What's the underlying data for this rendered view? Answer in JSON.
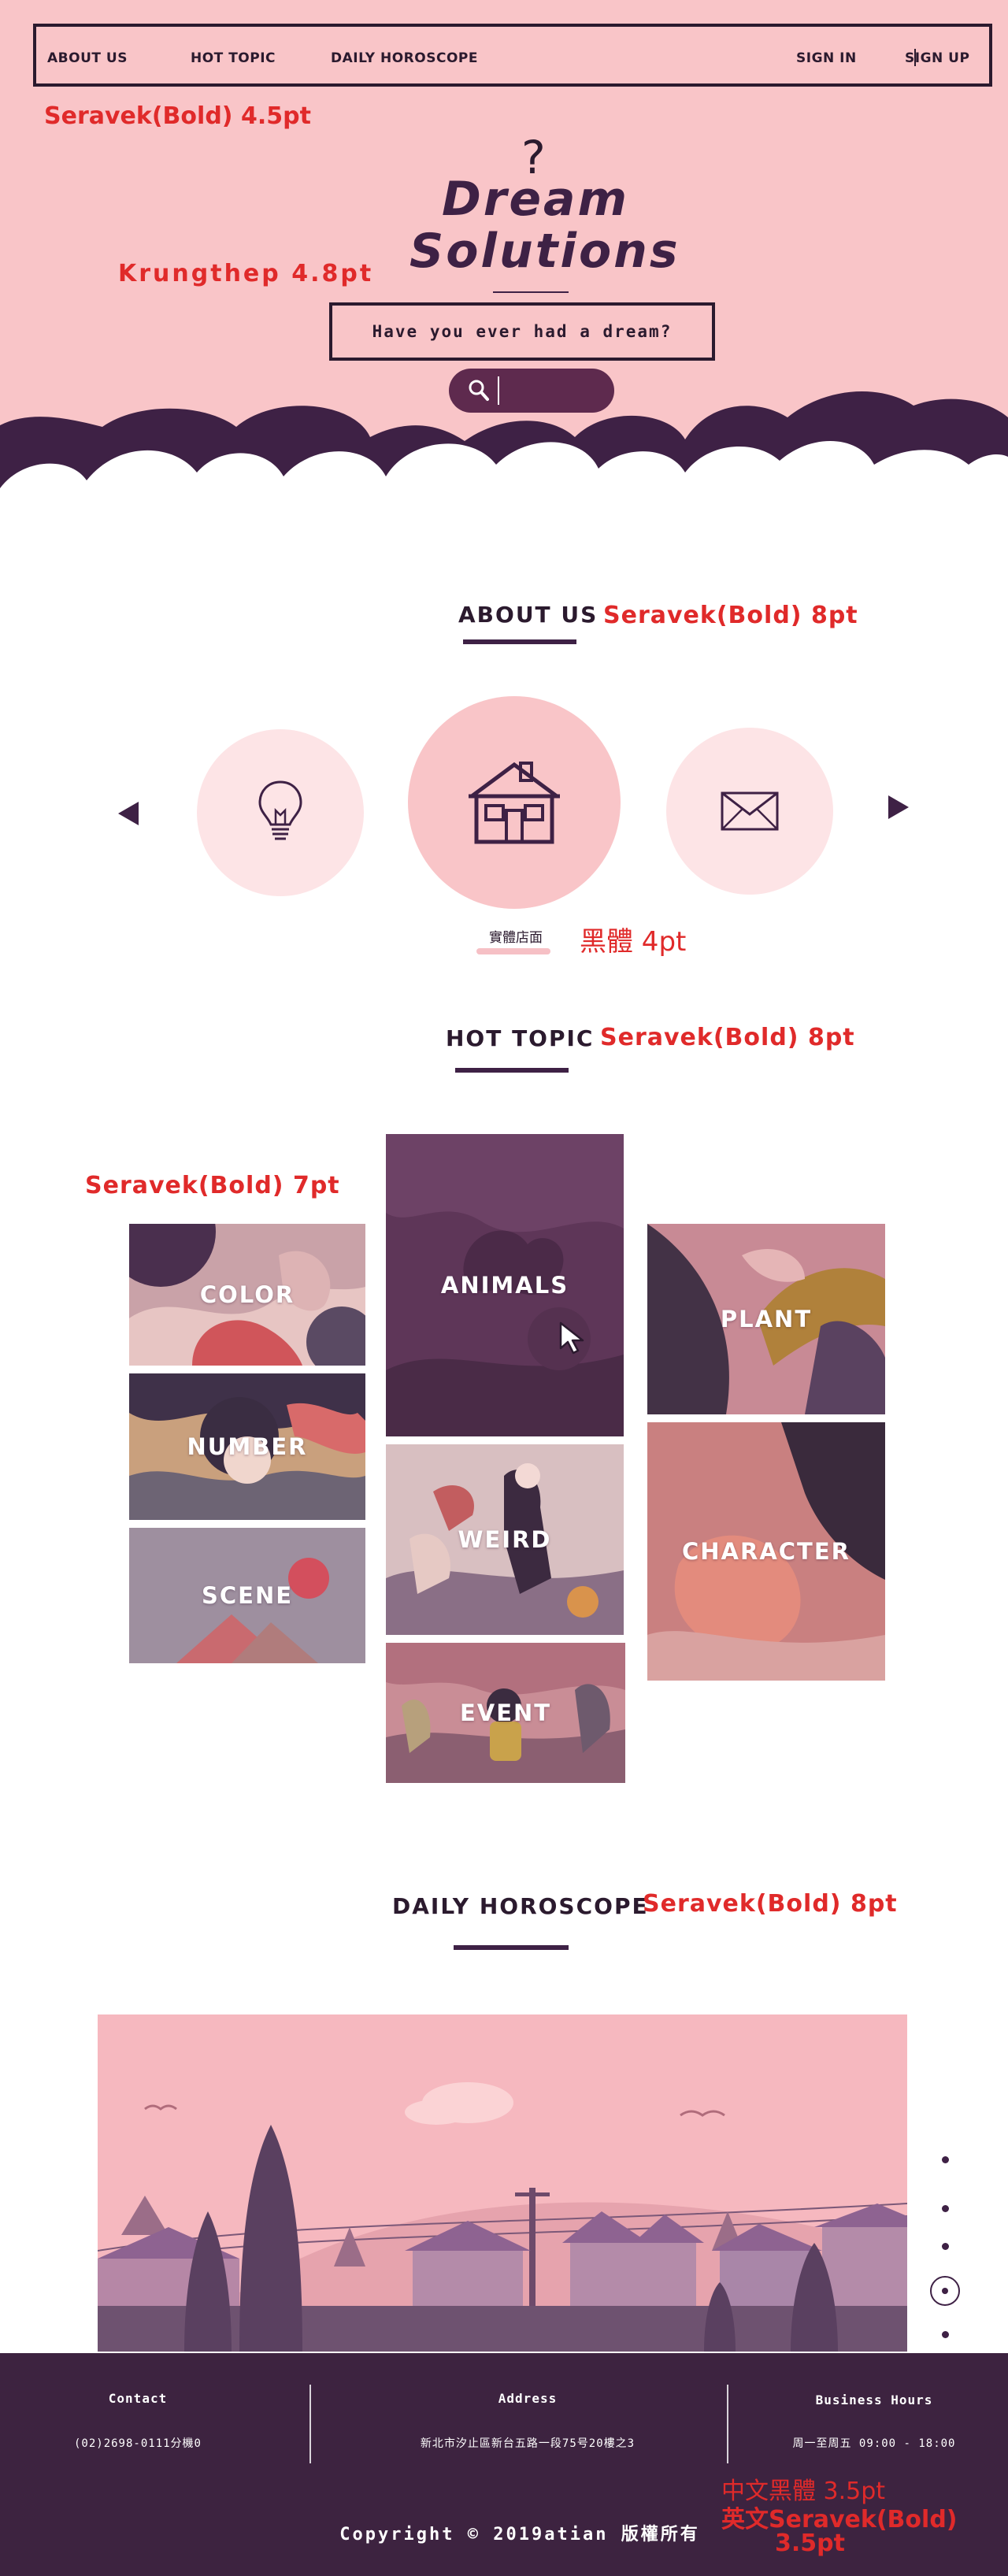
{
  "nav": {
    "about_us": "ABOUT US",
    "hot_topic": "HOT TOPIC",
    "daily_horoscope": "DAILY HOROSCOPE",
    "sign_in": "SIGN IN",
    "sign_up": "SIGN UP"
  },
  "hero": {
    "logo_mark": "?",
    "logo_line1": "Dream",
    "logo_line2": "Solutions",
    "prompt": "Have you ever had a dream?",
    "search_placeholder": ""
  },
  "annotations": {
    "nav_font": "Seravek(Bold)  4.5pt",
    "hero_font": "Krungthep  4.8pt",
    "about_font": "Seravek(Bold)  8pt",
    "store_font": "黑體 4pt",
    "hot_font": "Seravek(Bold)  8pt",
    "tile_font": "Seravek(Bold)  7pt",
    "horoscope_font": "Seravek(Bold)  8pt",
    "footer_font_cn": "中文黑體 3.5pt",
    "footer_font_en": "英文Seravek(Bold)",
    "footer_font_size": "3.5pt"
  },
  "about": {
    "title": "ABOUT US",
    "items": [
      {
        "icon": "lightbulb-icon"
      },
      {
        "icon": "house-icon",
        "label": "實體店面"
      },
      {
        "icon": "envelope-icon"
      }
    ]
  },
  "hot_topic": {
    "title": "HOT TOPIC",
    "tiles": [
      "COLOR",
      "NUMBER",
      "SCENE",
      "ANIMALS",
      "WEIRD",
      "EVENT",
      "PLANT",
      "CHARACTER"
    ]
  },
  "horoscope": {
    "title": "DAILY HOROSCOPE",
    "slide_dots": 5,
    "active_dot": 4
  },
  "footer": {
    "contact_title": "Contact",
    "contact_value": "(02)2698-0111分機0",
    "address_title": "Address",
    "address_value": "新北市汐止區新台五路一段75号20樓之3",
    "hours_title": "Business Hours",
    "hours_value": "周一至周五 09:00 - 18:00",
    "copyright": "Copyright © 2019atian 版權所有"
  },
  "colors": {
    "hero_pink": "#f9c5c8",
    "plum": "#3e2145",
    "annotation_red": "#e02a2a",
    "footer_bg": "#3d2340"
  }
}
